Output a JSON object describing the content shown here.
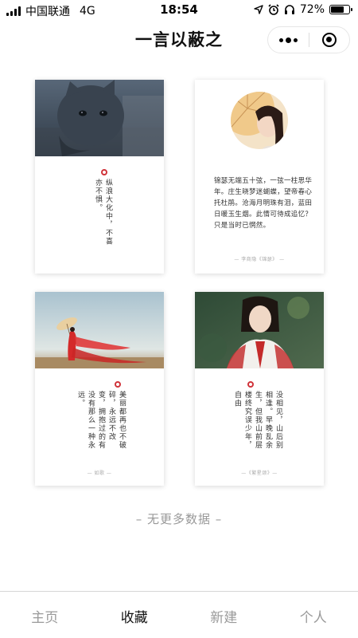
{
  "status": {
    "carrier": "中国联通",
    "network": "4G",
    "time": "18:54",
    "battery_text": "72%",
    "battery_level": 0.72
  },
  "nav": {
    "title": "一言以蔽之"
  },
  "cards": [
    {
      "text": "纵浪大化中，不喜亦不惧。",
      "credit": ""
    },
    {
      "text": "锦瑟无端五十弦，一弦一柱思华年。庄生晓梦迷蝴蝶，望帝春心托杜鹃。沧海月明珠有泪，蓝田日暖玉生烟。此情可待成追忆？只是当时已惘然。",
      "credit": "— 李商隐《锦瑟》 —"
    },
    {
      "text": "美丽都再也不破碎，永远不改变，拥抱过的有没有那么一种永远。",
      "credit": "— 如歌 —"
    },
    {
      "text": "没相见，山后别相逢。早晚乱余生，但我山前层楼终究误少年，自由",
      "credit": "—《繁星颂》—"
    }
  ],
  "footer_note": "– 无更多数据 –",
  "tabs": [
    {
      "label": "主页",
      "active": false
    },
    {
      "label": "收藏",
      "active": true
    },
    {
      "label": "新建",
      "active": false
    },
    {
      "label": "个人",
      "active": false
    }
  ],
  "colors": {
    "accent_red": "#d0333a",
    "tab_inactive": "#9a9a9a",
    "tab_active": "#111111"
  }
}
